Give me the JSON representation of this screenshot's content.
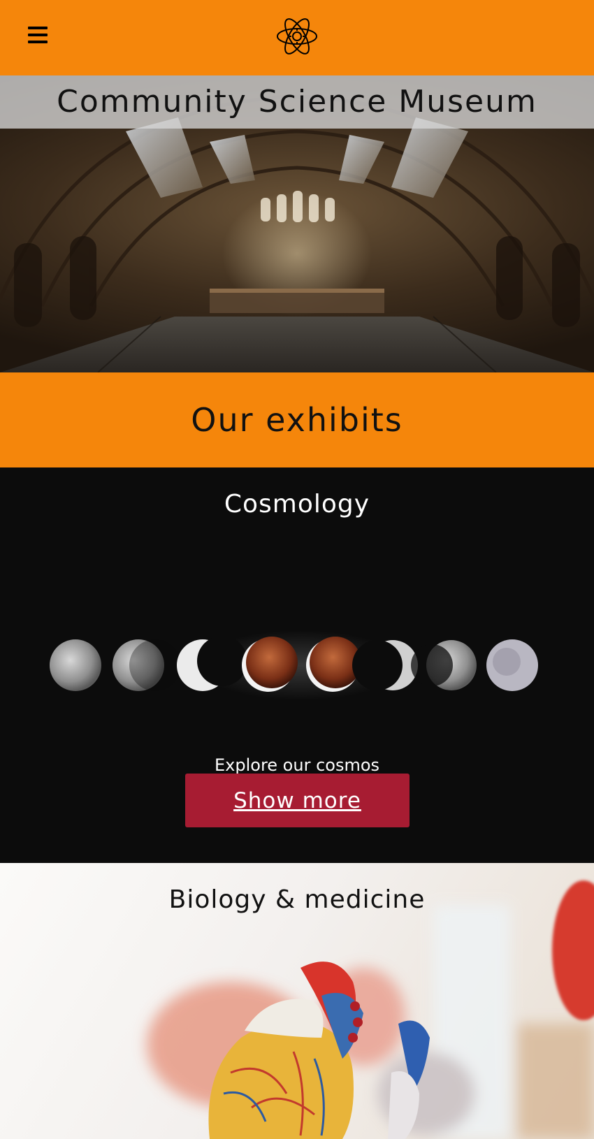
{
  "header": {
    "menu_icon": "hamburger-menu-icon",
    "logo_icon": "atom-icon",
    "accent_color": "#f5860b"
  },
  "hero": {
    "title": "Community Science Museum",
    "image": "museum-hall-photo"
  },
  "exhibits": {
    "heading": "Our exhibits"
  },
  "cosmology": {
    "heading": "Cosmology",
    "image": "lunar-eclipse-phases-photo",
    "caption": "Explore our cosmos",
    "button_label": "Show more",
    "button_color": "#a71c32"
  },
  "biology": {
    "heading": "Biology & medicine",
    "image": "anatomical-heart-model-photo"
  }
}
